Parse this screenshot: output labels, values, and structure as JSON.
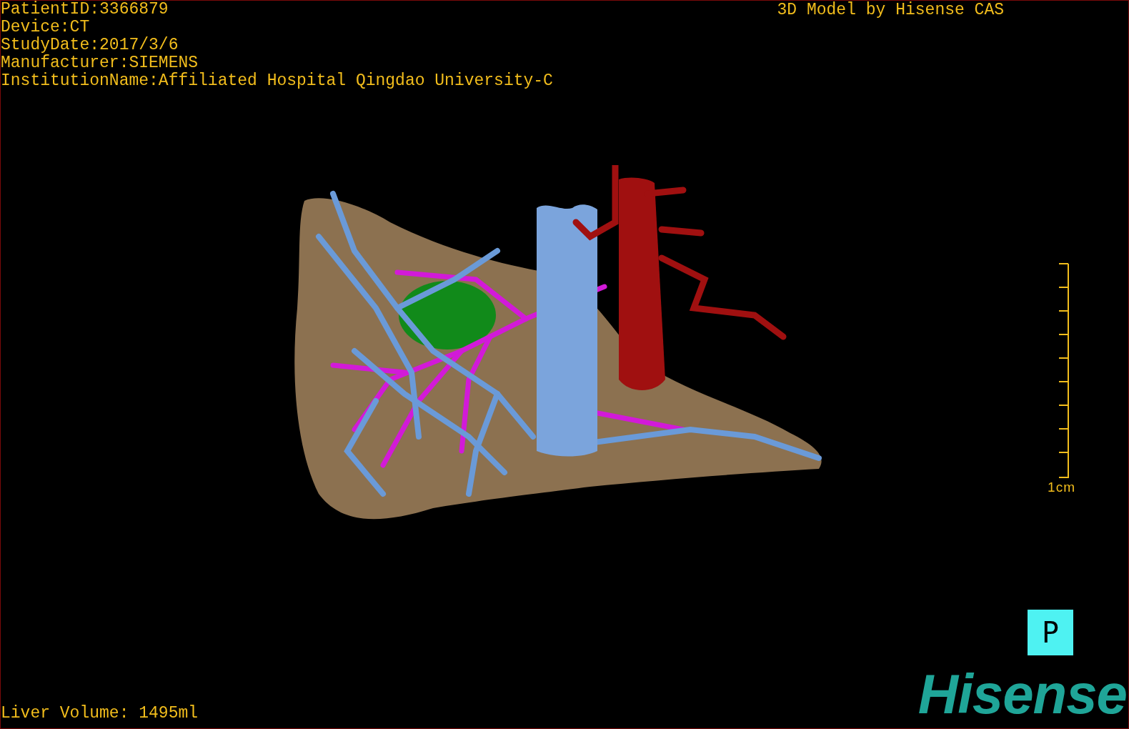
{
  "header": {
    "lines": [
      "PatientID:3366879",
      "Device:CT",
      "StudyDate:2017/3/6",
      "Manufacturer:SIEMENS",
      "InstitutionName:Affiliated Hospital Qingdao University-C"
    ]
  },
  "title": "3D Model by Hisense CAS",
  "scale_bar": {
    "label": "1cm"
  },
  "orientation_marker": "P",
  "footer": {
    "liver_volume": "Liver Volume: 1495ml"
  },
  "logo": "Hisense"
}
